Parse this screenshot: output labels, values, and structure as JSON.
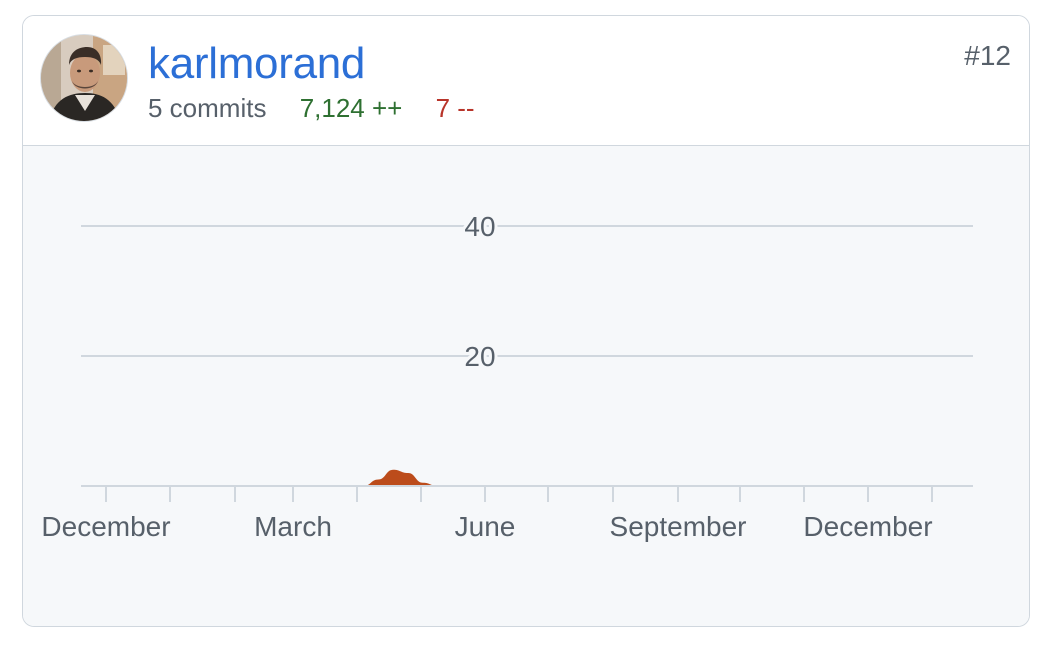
{
  "contributor": {
    "username": "karlmorand",
    "commits_text": "5 commits",
    "additions_text": "7,124 ++",
    "deletions_text": "7 --",
    "rank_text": "#12",
    "avatar": "user-avatar-photo"
  },
  "colors": {
    "username": "#2c6fd6",
    "additions": "#2e7031",
    "deletions": "#b8342a",
    "area_fill": "#bc4c1b",
    "grid": "#d0d7de",
    "chart_bg": "#f6f8fa"
  },
  "chart_data": {
    "type": "area",
    "title": "",
    "xlabel": "",
    "ylabel": "",
    "ylim": [
      0,
      45
    ],
    "y_ticks": [
      20,
      40
    ],
    "x_tick_labels": [
      "December",
      "March",
      "June",
      "September",
      "December"
    ],
    "x_tick_count": 14,
    "grid": true,
    "series": [
      {
        "values": [
          0,
          0,
          0,
          0,
          0,
          0,
          0,
          0,
          0,
          0,
          0,
          0,
          0,
          0,
          0,
          0,
          0,
          0,
          0,
          0,
          1,
          2.5,
          2,
          0.5,
          0,
          0,
          0,
          0,
          0,
          0,
          0,
          0,
          0,
          0,
          0,
          0,
          0,
          0,
          0,
          0,
          0,
          0,
          0,
          0,
          0,
          0,
          0,
          0,
          0,
          0,
          0,
          0,
          0,
          0,
          0,
          0,
          0,
          0,
          0,
          0,
          0
        ]
      }
    ]
  }
}
